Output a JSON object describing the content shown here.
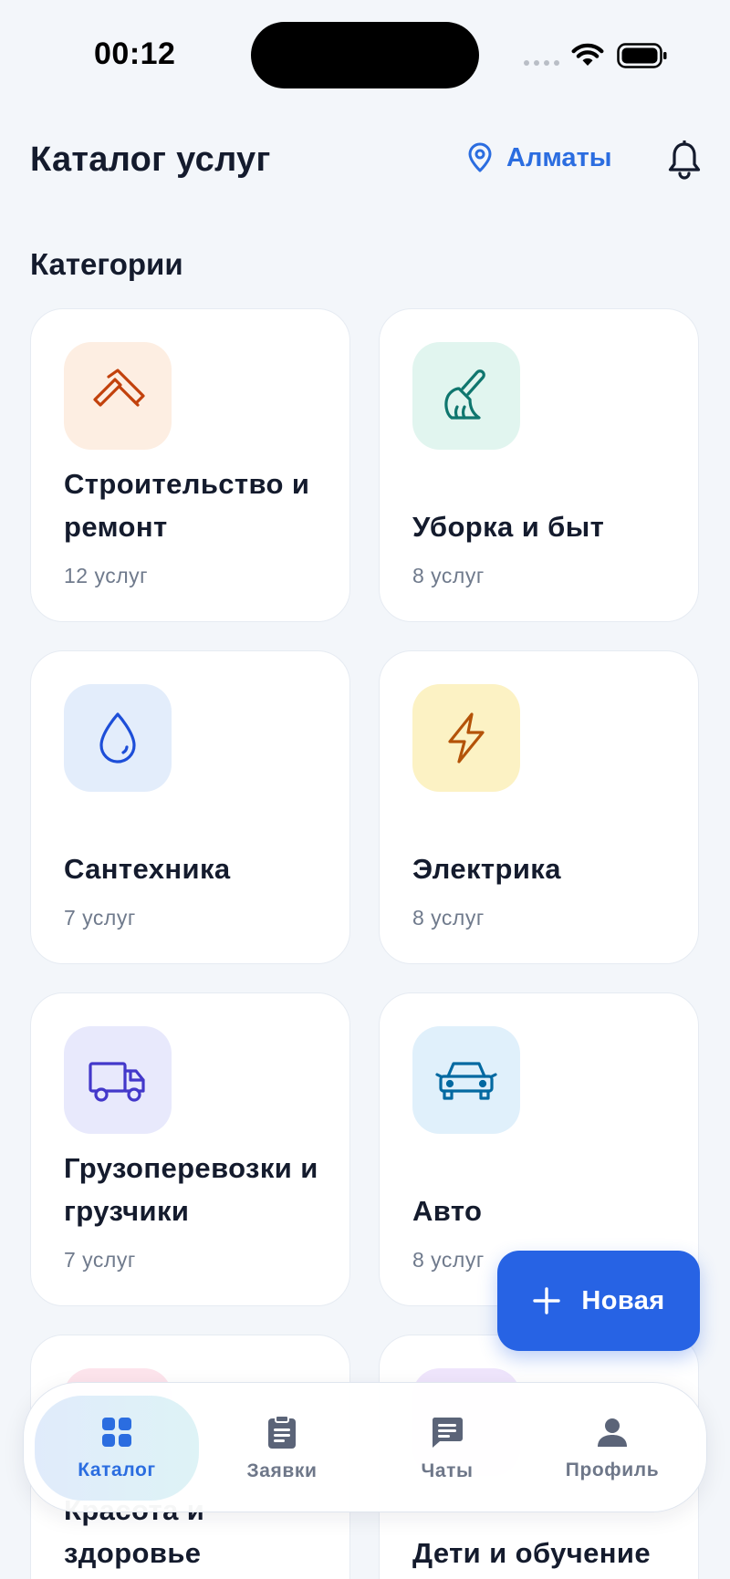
{
  "status_bar": {
    "time": "00:12"
  },
  "header": {
    "title": "Каталог услуг",
    "location": "Алматы"
  },
  "section_title": "Категории",
  "categories": [
    {
      "title": "Строительство и ремонт",
      "count": "12 услуг",
      "icon": "hammer-icon",
      "bg": "#fdeee2",
      "color": "#c2410c"
    },
    {
      "title": "Уборка и быт",
      "count": "8 услуг",
      "icon": "brush-icon",
      "bg": "#e1f5ef",
      "color": "#0f766e"
    },
    {
      "title": "Сантехника",
      "count": "7 услуг",
      "icon": "water-drop-icon",
      "bg": "#e3edfb",
      "color": "#1d4ed8"
    },
    {
      "title": "Электрика",
      "count": "8 услуг",
      "icon": "lightning-icon",
      "bg": "#fcf2c4",
      "color": "#b45309"
    },
    {
      "title": "Грузоперевозки и грузчики",
      "count": "7 услуг",
      "icon": "truck-icon",
      "bg": "#e8e9fc",
      "color": "#4338ca"
    },
    {
      "title": "Авто",
      "count": "8 услуг",
      "icon": "car-icon",
      "bg": "#e0f0fb",
      "color": "#0369a1"
    },
    {
      "title": "Красота и здоровье",
      "count": "",
      "icon": "beauty-icon",
      "bg": "#fde4ec",
      "color": "#be185d"
    },
    {
      "title": "Дети и обучение",
      "count": "",
      "icon": "kids-icon",
      "bg": "#efe5fc",
      "color": "#7e22ce"
    }
  ],
  "fab": {
    "label": "Новая"
  },
  "tabs": [
    {
      "label": "Каталог",
      "icon": "grid-icon",
      "active": true
    },
    {
      "label": "Заявки",
      "icon": "clipboard-icon",
      "active": false
    },
    {
      "label": "Чаты",
      "icon": "chat-icon",
      "active": false
    },
    {
      "label": "Профиль",
      "icon": "profile-icon",
      "active": false
    }
  ],
  "colors": {
    "accent": "#2763e4",
    "background": "#f3f6fa",
    "text": "#141b2d",
    "muted": "#6f7a8c"
  }
}
